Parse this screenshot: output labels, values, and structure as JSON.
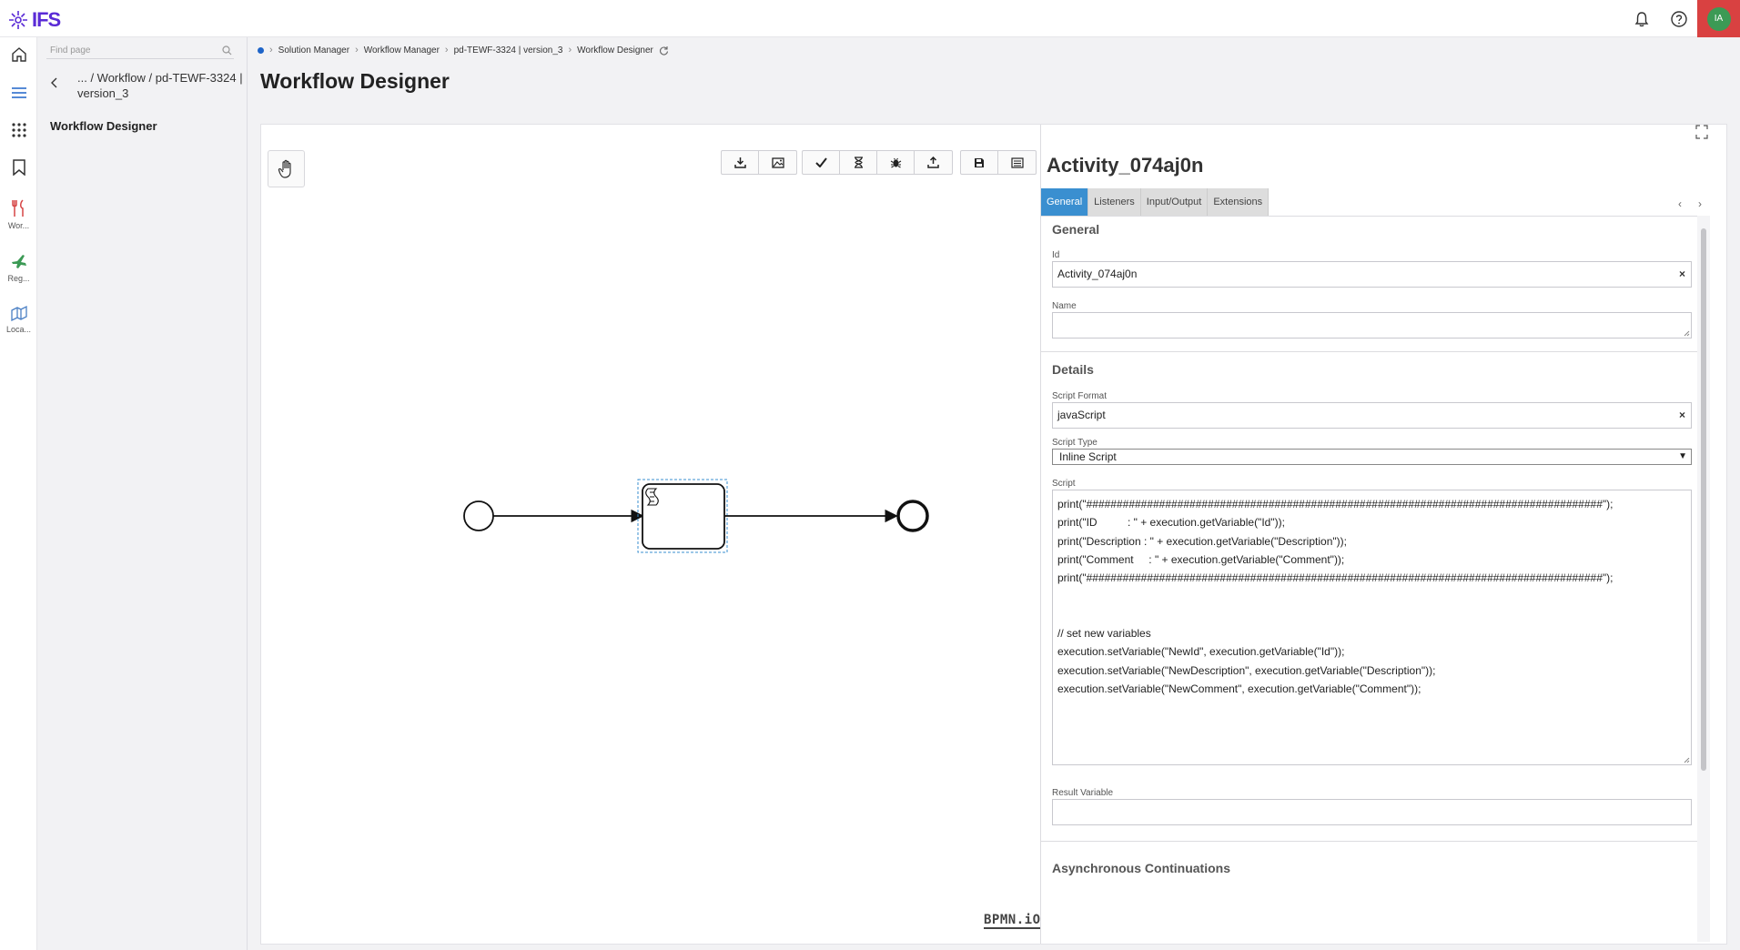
{
  "app": {
    "brand": "IFS",
    "user_initials": "IA"
  },
  "rail": {
    "items": [
      {
        "name": "home-icon",
        "label": ""
      },
      {
        "name": "menu-icon",
        "label": ""
      },
      {
        "name": "apps-grid-icon",
        "label": ""
      },
      {
        "name": "bookmark-icon",
        "label": ""
      },
      {
        "name": "workflow-icon",
        "label": "Wor..."
      },
      {
        "name": "plane-icon",
        "label": "Reg..."
      },
      {
        "name": "location-icon",
        "label": "Loca..."
      }
    ]
  },
  "nav": {
    "search_placeholder": "Find page",
    "path": "... / Workflow / pd-TEWF-3324 | version_3",
    "current": "Workflow Designer"
  },
  "breadcrumb": {
    "items": [
      "Solution Manager",
      "Workflow Manager",
      "pd-TEWF-3324 | version_3",
      "Workflow Designer"
    ]
  },
  "page": {
    "title": "Workflow Designer"
  },
  "toolbar": {
    "groups": [
      [
        "download-icon",
        "image-icon"
      ],
      [
        "check-icon",
        "hourglass-icon",
        "bug-icon",
        "upload-icon"
      ],
      [
        "save-icon",
        "list-icon"
      ]
    ]
  },
  "canvas": {
    "watermark": "BPMN.iO"
  },
  "properties": {
    "title": "Activity_074aj0n",
    "tabs": [
      "General",
      "Listeners",
      "Input/Output",
      "Extensions"
    ],
    "active_tab": "General",
    "general": {
      "section": "General",
      "id_label": "Id",
      "id_value": "Activity_074aj0n",
      "name_label": "Name",
      "name_value": ""
    },
    "details": {
      "section": "Details",
      "script_format_label": "Script Format",
      "script_format_value": "javaScript",
      "script_type_label": "Script Type",
      "script_type_value": "Inline Script",
      "script_label": "Script",
      "script_lines": [
        "print(\"#####################################################################################\");",
        "print(\"ID          : \" + execution.getVariable(\"Id\"));",
        "print(\"Description : \" + execution.getVariable(\"Description\"));",
        "print(\"Comment     : \" + execution.getVariable(\"Comment\"));",
        "print(\"#####################################################################################\");",
        "",
        "",
        "// set new variables",
        "execution.setVariable(\"NewId\", execution.getVariable(\"Id\"));",
        "execution.setVariable(\"NewDescription\", execution.getVariable(\"Description\"));",
        "execution.setVariable(\"NewComment\", execution.getVariable(\"Comment\"));"
      ],
      "result_variable_label": "Result Variable",
      "result_variable_value": ""
    },
    "async_section": "Asynchronous Continuations"
  }
}
